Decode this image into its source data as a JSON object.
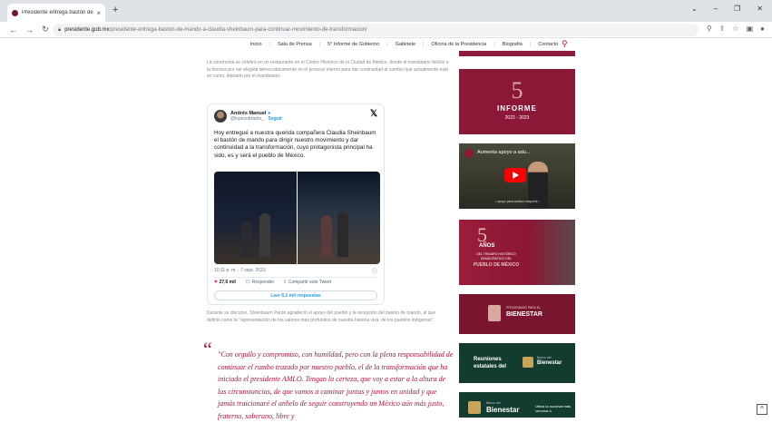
{
  "browser": {
    "tab_title": "Presidente entrega bastón de m",
    "tab_close": "×",
    "new_tab": "+",
    "window_controls": [
      "⌄",
      "–",
      "❐",
      "✕"
    ],
    "url_domain": "presidente.gob.mx",
    "url_path": "/presidente-entrega-baston-de-mando-a-claudia-sheinbaum-para-continuar-movimiento-de-transformacion/"
  },
  "site_nav": {
    "items": [
      "Inicio",
      "Sala de Prensa",
      "5° Informe de Gobierno",
      "Gabinete",
      "Oficina de la Presidencia",
      "Biografía",
      "Contacto"
    ]
  },
  "article": {
    "intro": "La ceremonia se celebró en un restaurante en el Centro Histórico de la Ciudad de México, donde el mandatario felicitó a la doctora por ser elegida democráticamente en el proceso interno para dar continuidad al cambio que actualmente está en curso, liderado por el mandatario.",
    "after_tweet": "Durante su discurso, Sheinbaum Pardo agradeció el apoyo del pueblo y la recepción del bastón de mando, al que definió como la \"representación de los valores más profundos de nuestra historia viva, de los pueblos indígenas\".",
    "quote": "\"Con orgullo y compromiso, con humildad, pero con la plena responsabilidad de continuar el rumbo trazado por nuestro pueblo, el de la transformación que ha iniciado el presidente AMLO. Tengan la certeza, que voy a estar a la altura de las circunstancias, de que vamos a caminar juntas y juntos en unidad y que jamás traicionaré el anhelo de seguir construyendo un México aún más justo, fraterno, soberano, libre y"
  },
  "tweet": {
    "name": "Andrés Manuel",
    "handle": "@lopezobrador_",
    "follow": "Seguir",
    "text": "Hoy entregué a nuestra querida compañera Claudia Sheinbaum el bastón de mando para dirigir nuestro movimiento y dar continuidad a la transformación, cuyo protagonista principal ha sido, es y será el pueblo de México.",
    "time": "10:11 p. m. · 7 sept. 2023",
    "likes": "27,6 mil",
    "reply": "Responder",
    "share": "Compartir este Tweet",
    "read_replies": "Leer 6,1 mil respuestas"
  },
  "rail": {
    "informe": {
      "number": "5",
      "label": "INFORME",
      "years": "2022 - 2023"
    },
    "video": {
      "title": "Aumenta apoyo a adu...",
      "caption": "• apoyo para adultos mayores •"
    },
    "anos": {
      "number": "5",
      "label": "AÑOS",
      "line1": "DEL TRIUNFO HISTÓRICO DEMOCRÁTICO DEL",
      "line2": "PUEBLO DE MÉXICO"
    },
    "bienestar": {
      "small": "PROGRAMAS PARA EL",
      "big": "BIENESTAR"
    },
    "reuniones": {
      "title": "Reuniones estatales del",
      "small": "Banco del",
      "big": "Bienestar"
    },
    "banco": {
      "small": "Banco del",
      "big": "Bienestar",
      "side": "Ubica la sucursal más cercana a"
    }
  },
  "colors": {
    "brand": "#8b1837",
    "quote": "#b0123a",
    "green": "#133c30"
  }
}
